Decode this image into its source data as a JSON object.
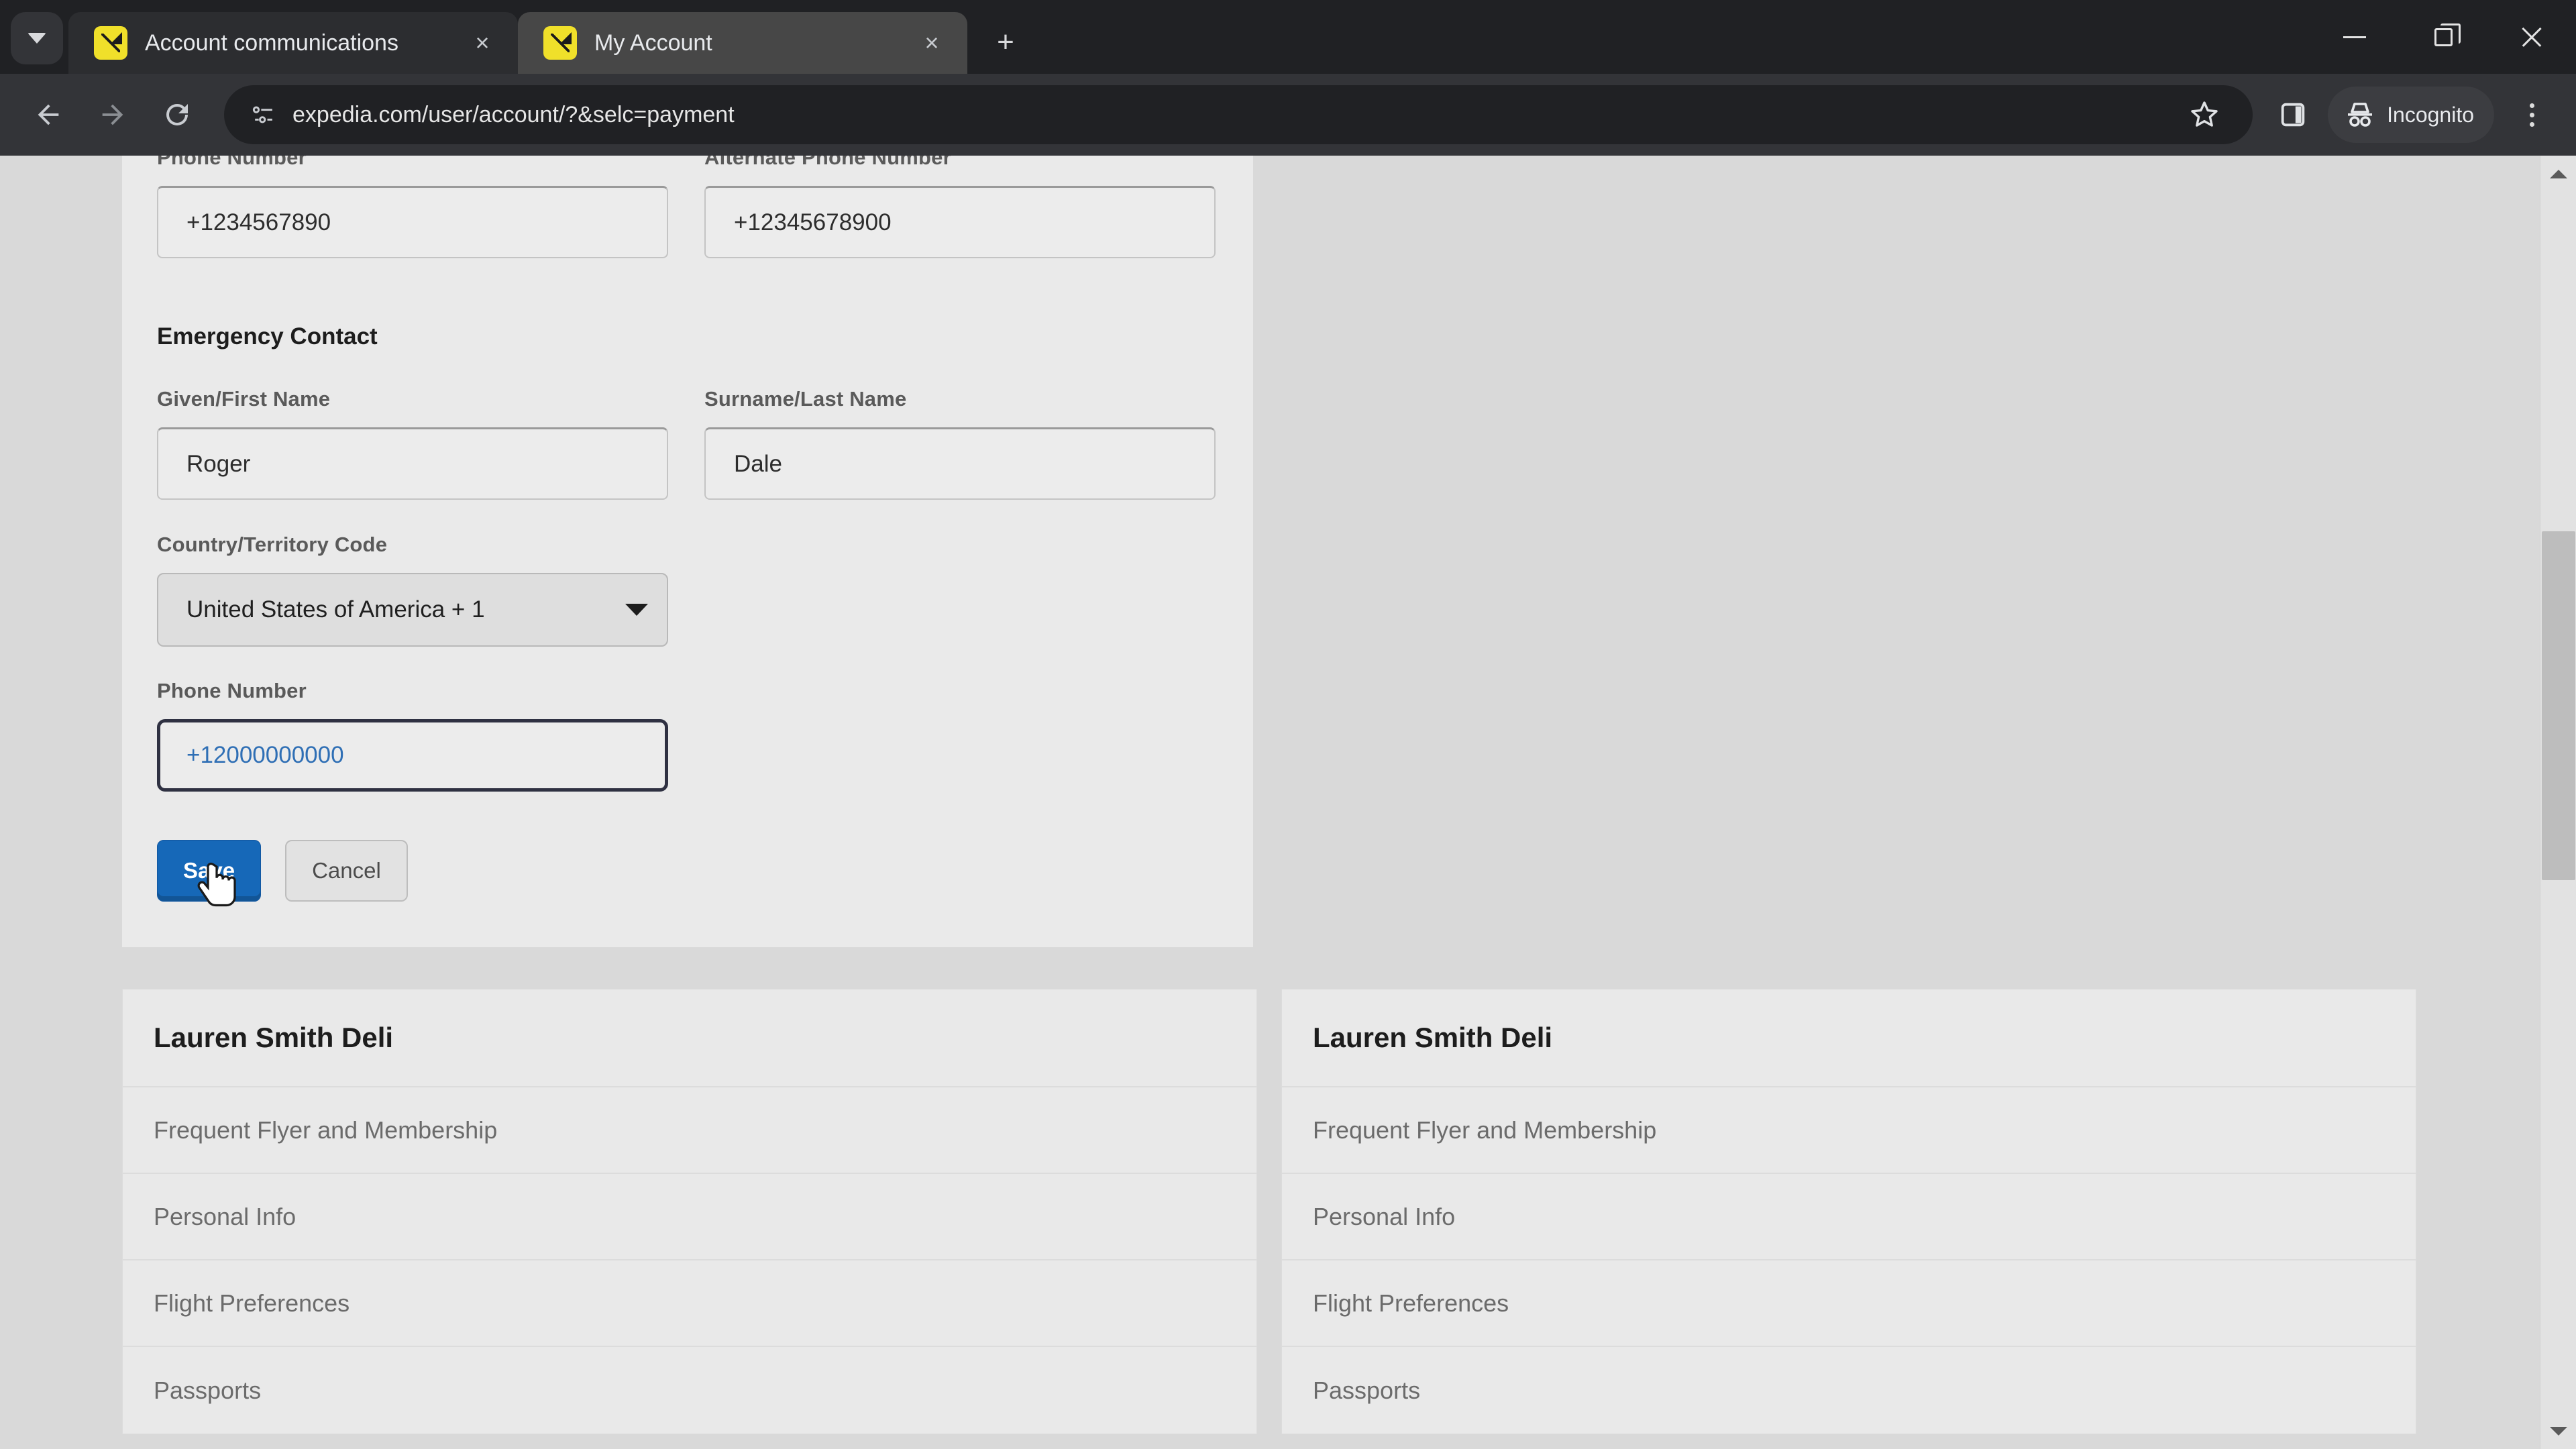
{
  "browser": {
    "tab_search_icon": "chevron-down-icon",
    "tabs": [
      {
        "title": "Account communications",
        "favicon": "expedia-favicon",
        "active": false,
        "close_label": "×"
      },
      {
        "title": "My Account",
        "favicon": "expedia-favicon",
        "active": true,
        "close_label": "×"
      }
    ],
    "new_tab_label": "+",
    "window_controls": {
      "minimize": "minimize-icon",
      "maximize": "maximize-icon",
      "close": "close-icon"
    },
    "toolbar": {
      "back_icon": "back-arrow-icon",
      "forward_icon": "forward-arrow-icon",
      "reload_icon": "reload-icon",
      "site_info_icon": "site-settings-icon",
      "url": "expedia.com/user/account/?&selc=payment",
      "url_placeholder": "Search Google or type a URL",
      "bookmark_icon": "star-icon",
      "sidepanel_icon": "side-panel-icon",
      "incognito_icon": "incognito-icon",
      "incognito_label": "Incognito",
      "menu_icon": "kebab-menu-icon"
    }
  },
  "form": {
    "phone_number_label": "Phone Number",
    "phone_number_value": "+1234567890",
    "alt_phone_label": "Alternate Phone Number",
    "alt_phone_value": "+12345678900",
    "emergency_contact_heading": "Emergency Contact",
    "first_name_label": "Given/First Name",
    "first_name_value": "Roger",
    "last_name_label": "Surname/Last Name",
    "last_name_value": "Dale",
    "country_code_label": "Country/Territory Code",
    "country_code_value": "United States of America + 1",
    "emergency_phone_label": "Phone Number",
    "emergency_phone_value": "+12000000000",
    "save_label": "Save",
    "cancel_label": "Cancel",
    "accent_color": "#1668b8",
    "focus_border_color": "#2f3142",
    "focus_text_color": "#2f6fb5"
  },
  "cards": [
    {
      "title": "Lauren Smith Deli",
      "rows": [
        "Frequent Flyer and Membership",
        "Personal Info",
        "Flight Preferences",
        "Passports"
      ]
    },
    {
      "title": "Lauren Smith Deli",
      "rows": [
        "Frequent Flyer and Membership",
        "Personal Info",
        "Flight Preferences",
        "Passports"
      ]
    }
  ],
  "scrollbar": {
    "up_icon": "scroll-up-arrow-icon",
    "down_icon": "scroll-down-arrow-icon"
  }
}
